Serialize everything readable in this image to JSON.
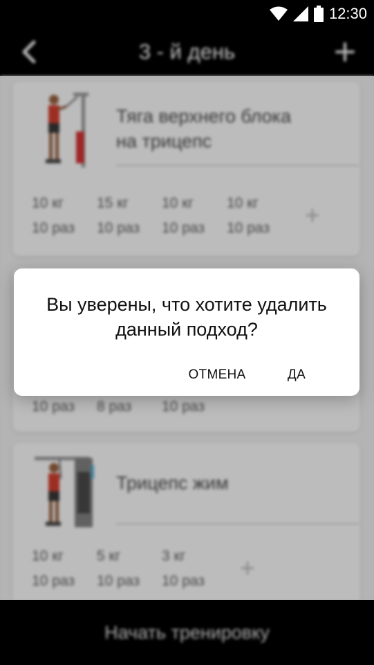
{
  "status_bar": {
    "time": "12:30",
    "icons": [
      "wifi-icon",
      "cell-signal-icon",
      "battery-icon"
    ]
  },
  "toolbar": {
    "title": "3 - й день",
    "back_icon": "chevron-left-icon",
    "add_icon": "plus-icon"
  },
  "exercises": [
    {
      "name_line1": "Тяга верхнего блока",
      "name_line2": "на трицепс",
      "sets": [
        {
          "weight": "10 кг",
          "reps": "10 раз"
        },
        {
          "weight": "15 кг",
          "reps": "10 раз"
        },
        {
          "weight": "10 кг",
          "reps": "10 раз"
        },
        {
          "weight": "10 кг",
          "reps": "10 раз"
        }
      ],
      "add_set": "+"
    },
    {
      "sets": [
        {
          "reps": "10 раз"
        },
        {
          "reps": "8 раз"
        },
        {
          "reps": "10 раз"
        }
      ]
    },
    {
      "name_line1": "Трицепс жим",
      "sets": [
        {
          "weight": "10 кг",
          "reps": "10 раз"
        },
        {
          "weight": "5 кг",
          "reps": "10 раз"
        },
        {
          "weight": "3 кг",
          "reps": "10 раз"
        }
      ],
      "add_set": "+"
    }
  ],
  "bottom": {
    "start_label": "Начать тренировку"
  },
  "dialog": {
    "message": "Вы уверены, что хотите удалить данный подход?",
    "cancel_label": "ОТМЕНА",
    "confirm_label": "ДА"
  },
  "colors": {
    "bar_background": "#000000",
    "card_background": "#e6e6e6",
    "dialog_background": "#ffffff"
  }
}
